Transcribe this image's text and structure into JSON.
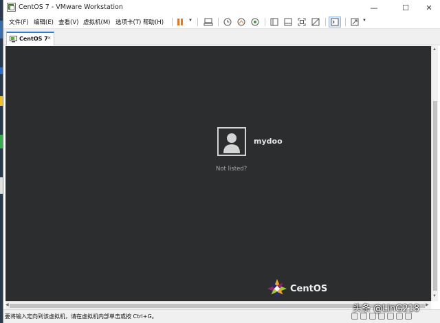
{
  "window": {
    "title": "CentOS 7 - VMware Workstation",
    "minimize": "—",
    "maximize": "☐",
    "close": "✕"
  },
  "menu": {
    "items": [
      "文件(F)",
      "编辑(E)",
      "查看(V)",
      "虚拟机(M)",
      "选项卡(T)",
      "帮助(H)"
    ]
  },
  "toolbar": {
    "icons": [
      "pause-icon",
      "send-ctrl-alt-del-icon",
      "snapshot-icon",
      "revert-snapshot-icon",
      "snapshot-manager-icon",
      "library-icon",
      "thumbnail-icon",
      "fullscreen-icon",
      "unity-icon",
      "console-icon",
      "stretch-icon"
    ],
    "accent_color": "#e87722"
  },
  "tab": {
    "label": "CentOS 7",
    "close": "×"
  },
  "vm_screen": {
    "background": "#2b2d2f",
    "user_name": "mydoo",
    "not_listed": "Not listed?",
    "brand": "CentOS"
  },
  "status": {
    "text": "要将输入定向到该虚拟机，请在虚拟机内部单击或按 Ctrl+G。"
  },
  "watermark": {
    "text": "头条 @LinG218"
  }
}
